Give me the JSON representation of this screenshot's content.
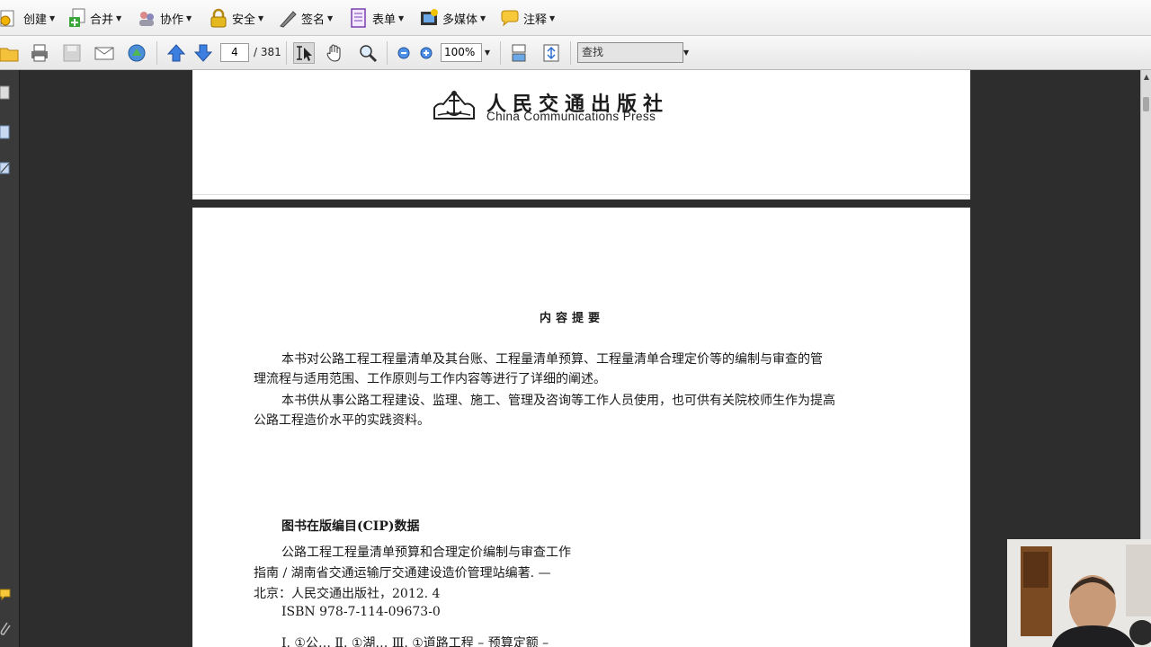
{
  "menu": {
    "items": [
      {
        "label": "创建",
        "icon": "create-icon"
      },
      {
        "label": "合并",
        "icon": "combine-icon"
      },
      {
        "label": "协作",
        "icon": "collaborate-icon"
      },
      {
        "label": "安全",
        "icon": "lock-icon"
      },
      {
        "label": "签名",
        "icon": "pen-icon"
      },
      {
        "label": "表单",
        "icon": "form-icon"
      },
      {
        "label": "多媒体",
        "icon": "multimedia-icon"
      },
      {
        "label": "注释",
        "icon": "comment-icon"
      }
    ]
  },
  "nav": {
    "page_current": "4",
    "page_total": "/ 381",
    "zoom": "100%",
    "find_placeholder": "查找"
  },
  "doc": {
    "publisher_cn": "人民交通出版社",
    "publisher_en": "China Communications Press",
    "summary_title": "内容提要",
    "summary_para1_line1": "本书对公路工程工程量清单及其台账、工程量清单预算、工程量清单合理定价等的编制与审查的管",
    "summary_para1_line2": "理流程与适用范围、工作原则与工作内容等进行了详细的阐述。",
    "summary_para2_line1": "本书供从事公路工程建设、监理、施工、管理及咨询等工作人员使用，也可供有关院校师生作为提高",
    "summary_para2_line2": "公路工程造价水平的实践资料。",
    "cip_title": "图书在版编目(CIP)数据",
    "cip_line1": "公路工程工程量清单预算和合理定价编制与审查工作",
    "cip_line2": "指南 / 湖南省交通运输厅交通建设造价管理站编著. —",
    "cip_line3": "北京：人民交通出版社，2012. 4",
    "cip_line4": "ISBN 978-7-114-09673-0",
    "cip_line5": "Ⅰ. ①公…   Ⅱ. ①湖…   Ⅲ. ①道路工程 – 预算定额 –"
  },
  "colors": {
    "toolbar_bg": "#ececec",
    "doc_bg": "#2d2d2d",
    "page_bg": "#ffffff",
    "nav_arrow_blue": "#2f6fd6"
  }
}
